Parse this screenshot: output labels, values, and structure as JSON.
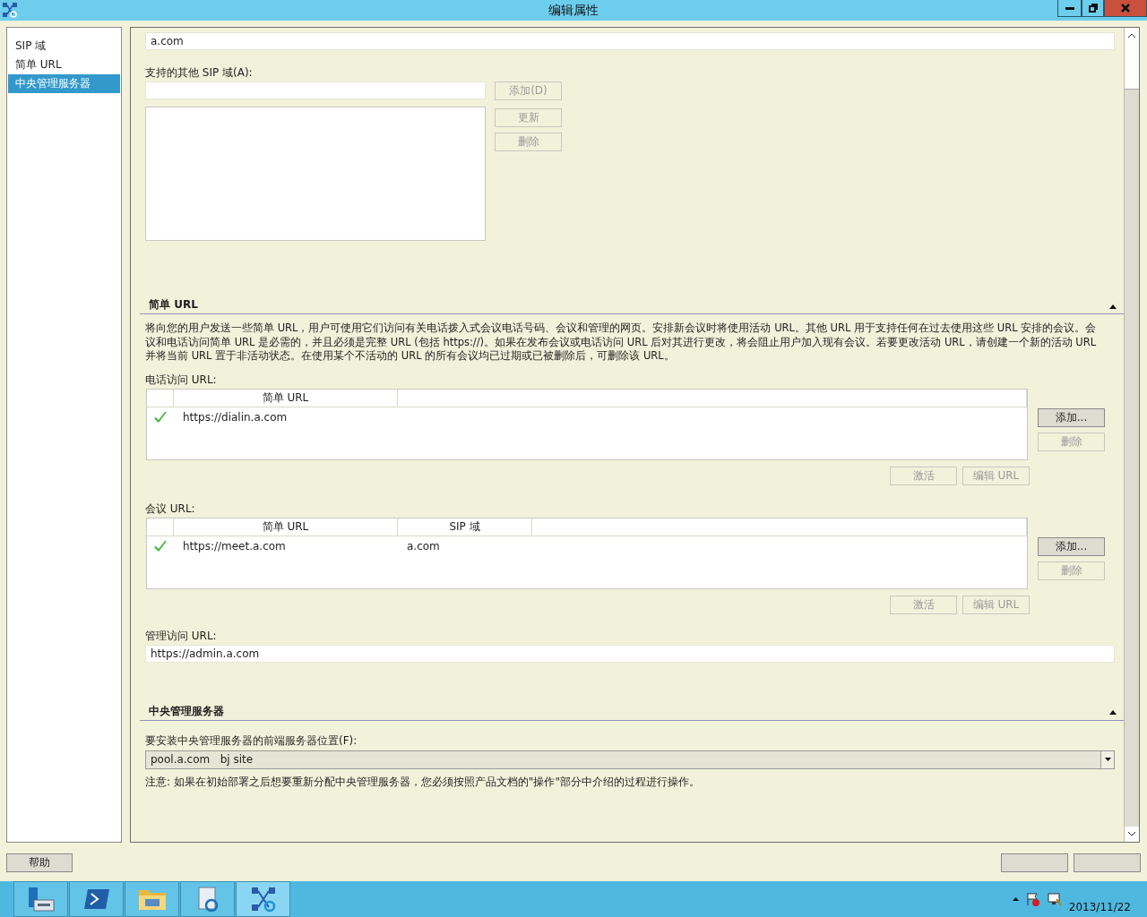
{
  "window": {
    "title": "编辑属性"
  },
  "nav": {
    "items": [
      {
        "label": "SIP 域",
        "selected": false
      },
      {
        "label": "简单 URL",
        "selected": false
      },
      {
        "label": "中央管理服务器",
        "selected": true
      }
    ]
  },
  "sip_domain": {
    "value": "a.com",
    "other_label": "支持的其他 SIP 域(A):",
    "buttons": [
      {
        "label": "添加(D)",
        "disabled": true
      },
      {
        "label": "更新",
        "disabled": true
      },
      {
        "label": "删除",
        "disabled": true
      }
    ]
  },
  "simple_url": {
    "header": "简单 URL",
    "expanded": true,
    "description": "将向您的用户发送一些简单 URL，用户可使用它们访问有关电话拨入式会议电话号码、会议和管理的网页。安排新会议时将使用活动 URL。其他 URL 用于支持任何在过去使用这些 URL 安排的会议。会议和电话访问简单 URL 是必需的，并且必须是完整 URL (包括 https://)。如果在发布会议或电话访问 URL 后对其进行更改，将会阻止用户加入现有会议。若要更改活动 URL，请创建一个新的活动 URL 并将当前 URL 置于非活动状态。在使用某个不活动的 URL 的所有会议均已过期或已被删除后，可删除该 URL。",
    "grids": [
      {
        "label": "电话访问 URL:",
        "columns": [
          "简单 URL"
        ],
        "rows": [
          {
            "active": true,
            "cells": [
              "https://dialin.a.com"
            ]
          }
        ],
        "side_buttons": [
          {
            "label": "添加...",
            "disabled": false
          },
          {
            "label": "删除",
            "disabled": true
          }
        ],
        "bottom_buttons": [
          {
            "label": "激活",
            "disabled": true
          },
          {
            "label": "编辑 URL",
            "disabled": true
          }
        ]
      },
      {
        "label": "会议 URL:",
        "columns": [
          "简单 URL",
          "SIP 域"
        ],
        "rows": [
          {
            "active": true,
            "cells": [
              "https://meet.a.com",
              "a.com"
            ]
          }
        ],
        "side_buttons": [
          {
            "label": "添加...",
            "disabled": false
          },
          {
            "label": "删除",
            "disabled": true
          }
        ],
        "bottom_buttons": [
          {
            "label": "激活",
            "disabled": true
          },
          {
            "label": "编辑 URL",
            "disabled": true
          }
        ]
      }
    ],
    "admin_label": "管理访问 URL:",
    "admin_value": "https://admin.a.com"
  },
  "cms": {
    "header": "中央管理服务器",
    "expanded": true,
    "label": "要安装中央管理服务器的前端服务器位置(F):",
    "value": "pool.a.com   bj site",
    "note": "注意: 如果在初始部署之后想要重新分配中央管理服务器，您必须按照产品文档的\"操作\"部分中介绍的过程进行操作。"
  },
  "footer": {
    "help": "帮助"
  },
  "taskbar": {
    "date": "2013/11/22"
  }
}
